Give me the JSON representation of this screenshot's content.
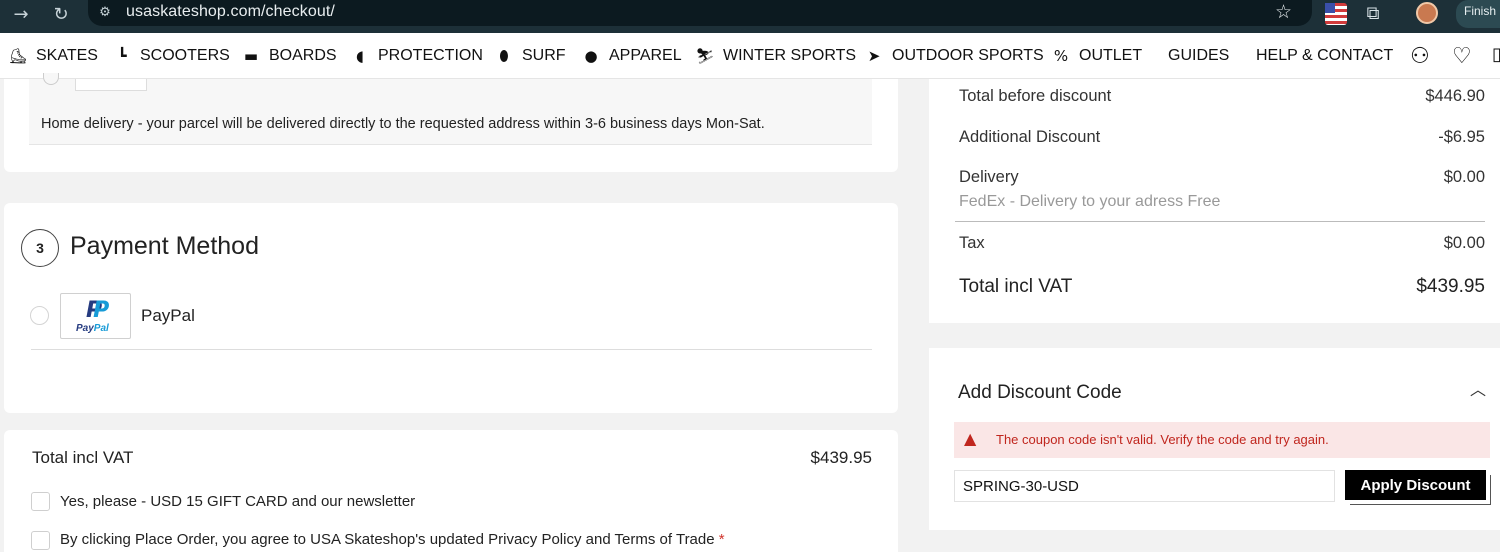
{
  "browser": {
    "url": "usaskateshop.com/checkout/",
    "finish_label": "Finish"
  },
  "nav": {
    "items": [
      {
        "label": "SKATES",
        "icon": "skate-icon"
      },
      {
        "label": "SCOOTERS",
        "icon": "scooter-icon"
      },
      {
        "label": "BOARDS",
        "icon": "board-icon"
      },
      {
        "label": "PROTECTION",
        "icon": "helmet-icon"
      },
      {
        "label": "SURF",
        "icon": "surfboard-icon"
      },
      {
        "label": "APPAREL",
        "icon": "hoodie-icon"
      },
      {
        "label": "WINTER SPORTS",
        "icon": "ski-icon"
      },
      {
        "label": "OUTDOOR SPORTS",
        "icon": "outdoor-icon"
      },
      {
        "label": "OUTLET",
        "icon": "percent-icon"
      },
      {
        "label": "GUIDES"
      },
      {
        "label": "HELP & CONTACT"
      }
    ]
  },
  "delivery": {
    "description": "Home delivery - your parcel will be delivered directly to the requested address within 3-6 business days Mon-Sat."
  },
  "payment": {
    "step": "3",
    "title": "Payment Method",
    "option_label": "PayPal",
    "logo_text_a": "Pay",
    "logo_text_b": "Pal",
    "logo_mark_a": "P",
    "logo_mark_b": "P"
  },
  "totals": {
    "label": "Total incl VAT",
    "value": "$439.95",
    "newsletter_label": "Yes, please - USD 15 GIFT CARD and our newsletter",
    "terms_label": "By clicking Place Order, you agree to USA Skateshop's updated Privacy Policy and Terms of Trade",
    "required_mark": "*"
  },
  "summary": {
    "rows": [
      {
        "label": "Total before discount",
        "value": "$446.90"
      },
      {
        "label": "Additional Discount",
        "value": "-$6.95"
      },
      {
        "label": "Delivery",
        "value": "$0.00"
      },
      {
        "label": "Tax",
        "value": "$0.00"
      },
      {
        "label": "Total incl VAT",
        "value": "$439.95"
      }
    ],
    "delivery_note": "FedEx - Delivery to your adress Free"
  },
  "discount": {
    "title": "Add Discount Code",
    "error": "The coupon code isn't valid. Verify the code and try again.",
    "code_value": "SPRING-30-USD",
    "button_label": "Apply Discount"
  },
  "colors": {
    "chrome_bg": "#1d3038",
    "error_text": "#c0261e",
    "error_bg": "#fae6e6",
    "paypal_dark": "#253b80",
    "paypal_light": "#179bd7"
  }
}
